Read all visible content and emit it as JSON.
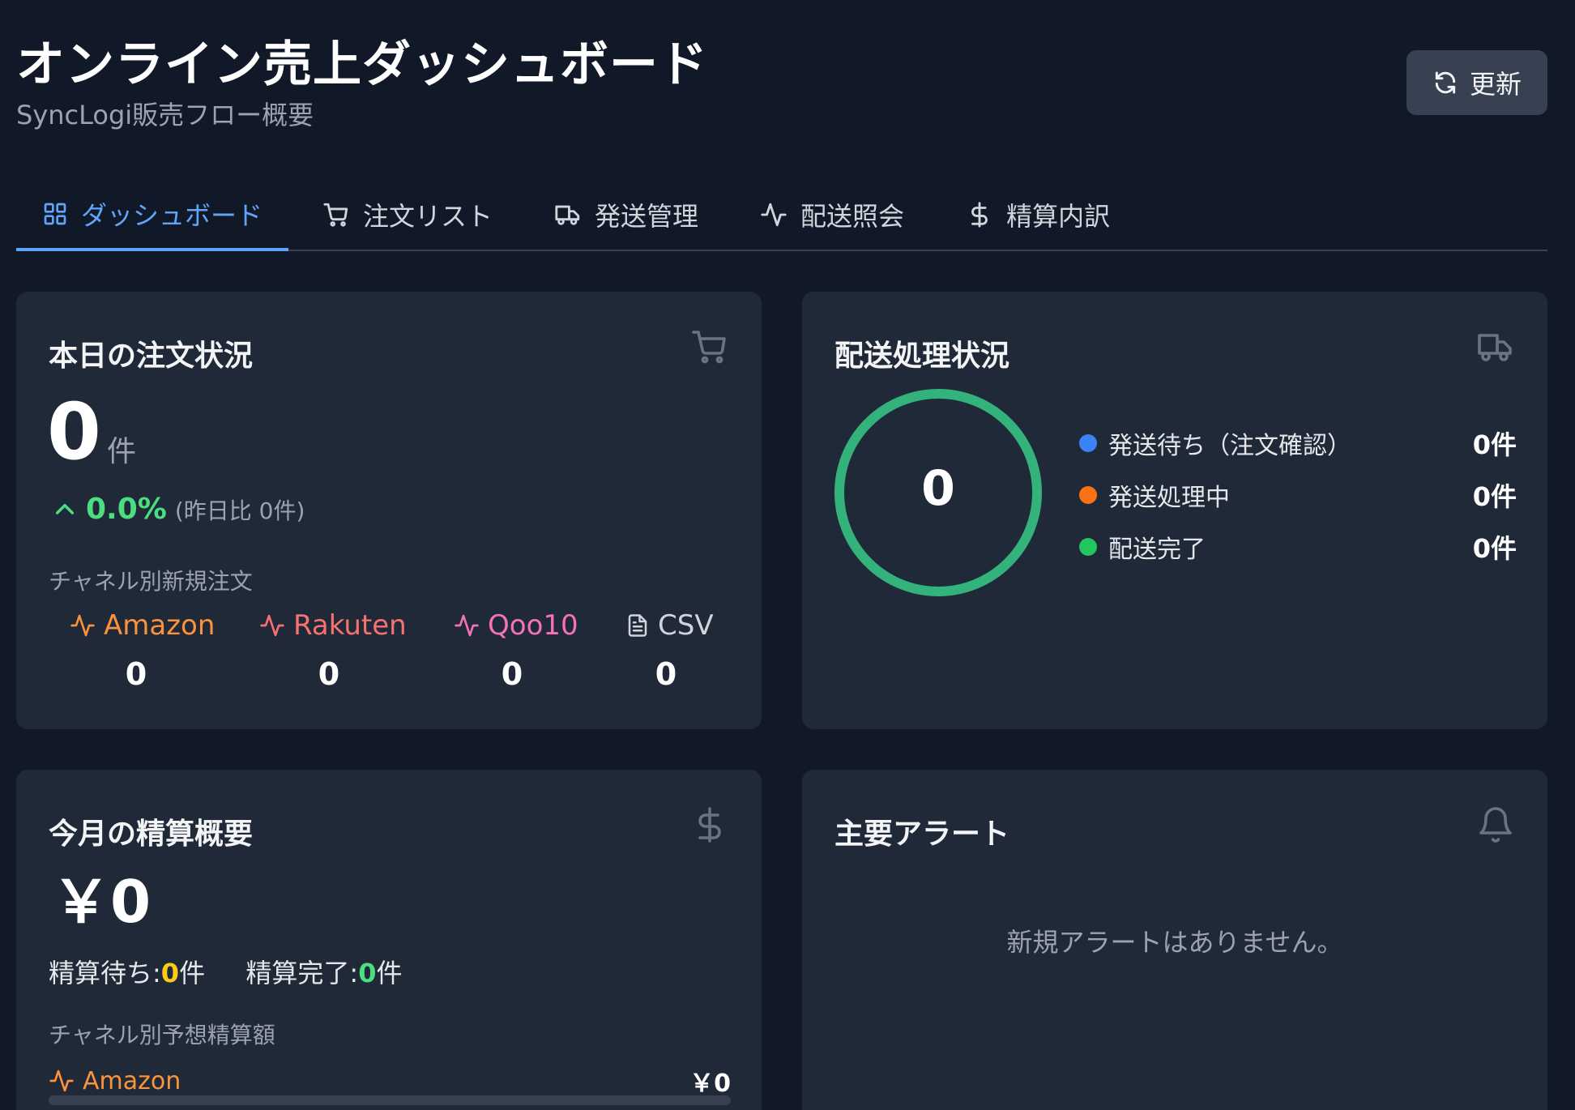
{
  "header": {
    "title": "オンライン売上ダッシュボード",
    "subtitle": "SyncLogi販売フロー概要",
    "refresh_label": "更新"
  },
  "tabs": [
    {
      "label": "ダッシュボード",
      "icon": "grid-icon",
      "active": true
    },
    {
      "label": "注文リスト",
      "icon": "cart-icon"
    },
    {
      "label": "発送管理",
      "icon": "truck-icon"
    },
    {
      "label": "配送照会",
      "icon": "activity-icon"
    },
    {
      "label": "精算内訳",
      "icon": "dollar-icon"
    }
  ],
  "orders": {
    "title": "本日の注文状況",
    "count": "0",
    "unit": "件",
    "change_pct": "0.0%",
    "change_note": "(昨日比 0件)",
    "channel_heading": "チャネル別新規注文",
    "channels": [
      {
        "name": "Amazon",
        "count": "0",
        "color": "#fb923c"
      },
      {
        "name": "Rakuten",
        "count": "0",
        "color": "#f87171"
      },
      {
        "name": "Qoo10",
        "count": "0",
        "color": "#f472b6"
      },
      {
        "name": "CSV",
        "count": "0",
        "color": "#d1d5db"
      }
    ]
  },
  "shipping": {
    "title": "配送処理状況",
    "total": "0",
    "ring_color": "#34b27b",
    "legend": [
      {
        "label": "発送待ち（注文確認）",
        "value": "0件",
        "color": "#3b82f6"
      },
      {
        "label": "発送処理中",
        "value": "0件",
        "color": "#f97316"
      },
      {
        "label": "配送完了",
        "value": "0件",
        "color": "#22c55e"
      }
    ]
  },
  "settlement": {
    "title": "今月の精算概要",
    "amount": "￥0",
    "pending_label": "精算待ち:",
    "pending_count": "0",
    "pending_unit": "件",
    "done_label": "精算完了:",
    "done_count": "0",
    "done_unit": "件",
    "channel_heading": "チャネル別予想精算額",
    "channel_name": "Amazon",
    "channel_amount": "￥0",
    "channel_color": "#fb923c"
  },
  "alerts": {
    "title": "主要アラート",
    "empty_message": "新規アラートはありません。"
  }
}
